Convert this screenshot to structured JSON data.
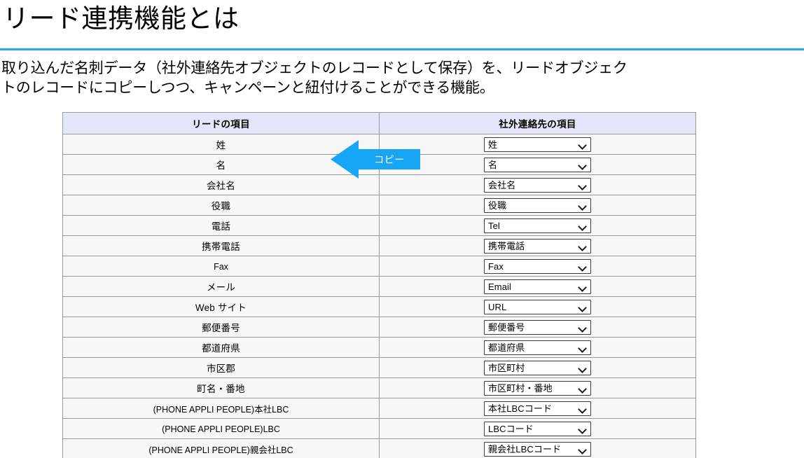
{
  "slide": {
    "title": "リード連携機能とは",
    "rule_color": "#23a9e8",
    "body_lines": [
      "取り込んだ名刺データ（社外連絡先オブジェクトのレコードとして保存）を、リードオブジェク",
      "トのレコードにコピーしつつ、キャンペーンと紐付けることができる機能。"
    ]
  },
  "annotation": {
    "arrow_label": "コピー",
    "arrow_color": "#16a6f5",
    "arrow_direction": "left"
  },
  "table": {
    "headers": [
      "リードの項目",
      "社外連絡先の項目"
    ],
    "rows": [
      {
        "lead": "姓",
        "contact": "姓",
        "lead_is_latin": false
      },
      {
        "lead": "名",
        "contact": "名",
        "lead_is_latin": false
      },
      {
        "lead": "会社名",
        "contact": "会社名",
        "lead_is_latin": false
      },
      {
        "lead": "役職",
        "contact": "役職",
        "lead_is_latin": false
      },
      {
        "lead": "電話",
        "contact": "Tel",
        "lead_is_latin": false
      },
      {
        "lead": "携帯電話",
        "contact": "携帯電話",
        "lead_is_latin": false
      },
      {
        "lead": "Fax",
        "contact": "Fax",
        "lead_is_latin": true
      },
      {
        "lead": "メール",
        "contact": "Email",
        "lead_is_latin": false
      },
      {
        "lead": "Web サイト",
        "contact": "URL",
        "lead_is_latin": false
      },
      {
        "lead": "郵便番号",
        "contact": "郵便番号",
        "lead_is_latin": false
      },
      {
        "lead": "都道府県",
        "contact": "都道府県",
        "lead_is_latin": false
      },
      {
        "lead": "市区郡",
        "contact": "市区町村",
        "lead_is_latin": false
      },
      {
        "lead": "町名・番地",
        "contact": "市区町村・番地",
        "lead_is_latin": false
      },
      {
        "lead": "(PHONE APPLI PEOPLE)本社LBC",
        "contact": "本社LBCコード",
        "lead_is_latin": true
      },
      {
        "lead": "(PHONE APPLI PEOPLE)LBC",
        "contact": "LBCコード",
        "lead_is_latin": true
      },
      {
        "lead": "(PHONE APPLI PEOPLE)親会社LBC",
        "contact": "親会社LBCコード",
        "lead_is_latin": true
      }
    ],
    "header_bg": "#e2e6f8",
    "row_bg": "#f7f7f7",
    "border_color": "#9a9a9a"
  }
}
